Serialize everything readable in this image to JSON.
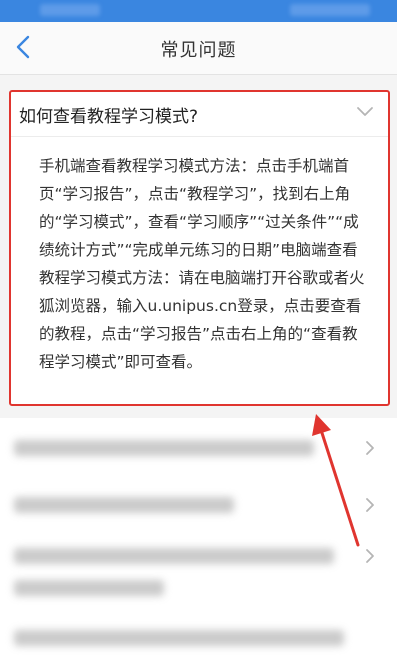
{
  "header": {
    "title": "常见问题",
    "back_icon": "chevron-left-icon"
  },
  "faq": {
    "expanded": {
      "question": "如何查看教程学习模式?",
      "answer": "手机端查看教程学习模式方法：点击手机端首页“学习报告”，点击“教程学习”，找到右上角的“学习模式”，查看“学习顺序”“过关条件”“成绩统计方式”“完成单元练习的日期”电脑端查看教程学习模式方法：请在电脑端打开谷歌或者火狐浏览器，输入u.unipus.cn登录，点击要查看的教程，点击“学习报告”点击右上角的“查看教程学习模式”即可查看。"
    }
  },
  "colors": {
    "statusbar": "#3a86e0",
    "highlight": "#e0352f",
    "chevron": "#b5b5b5",
    "back": "#3a86e0"
  }
}
